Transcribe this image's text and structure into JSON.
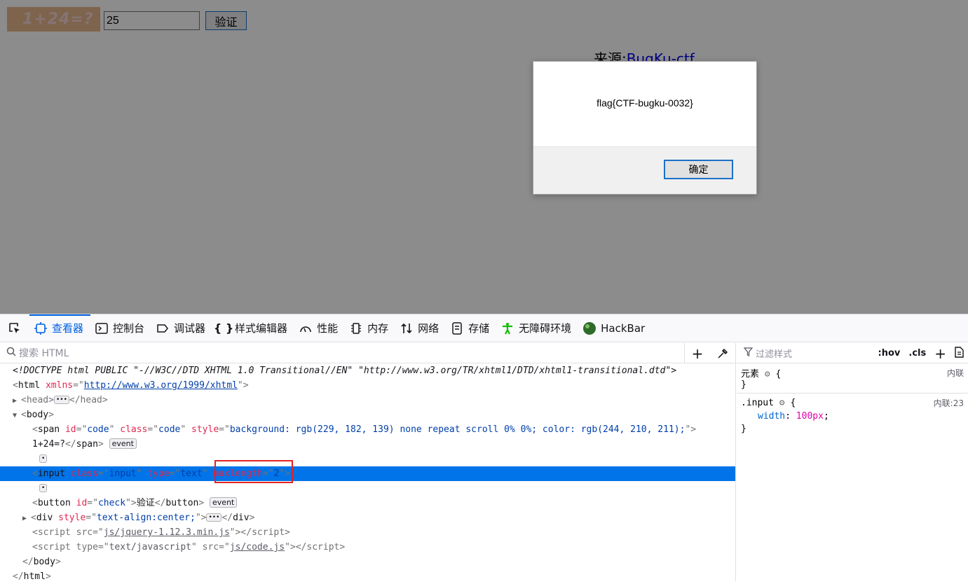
{
  "page": {
    "captcha_text": "1+24=?",
    "answer_value": "25",
    "verify_label": "验证",
    "source_prefix": "来源:",
    "source_link": "BugKu-ctf"
  },
  "dialog": {
    "message": "flag{CTF-bugku-0032}",
    "ok_label": "确定"
  },
  "devtools": {
    "tabs": [
      {
        "label": "查看器",
        "icon": "inspector-icon"
      },
      {
        "label": "控制台",
        "icon": "console-icon"
      },
      {
        "label": "调试器",
        "icon": "debugger-icon"
      },
      {
        "label": "样式编辑器",
        "icon": "style-editor-icon"
      },
      {
        "label": "性能",
        "icon": "performance-icon"
      },
      {
        "label": "内存",
        "icon": "memory-icon"
      },
      {
        "label": "网络",
        "icon": "network-icon"
      },
      {
        "label": "存储",
        "icon": "storage-icon"
      },
      {
        "label": "无障碍环境",
        "icon": "accessibility-icon"
      },
      {
        "label": "HackBar",
        "icon": "hackbar-icon"
      }
    ],
    "search_placeholder": "搜索 HTML",
    "filter_placeholder": "过滤样式",
    "hov_label": ":hov",
    "cls_label": ".cls",
    "markup": {
      "doctype": "<!DOCTYPE html PUBLIC \"-//W3C//DTD XHTML 1.0 Transitional//EN\" \"http://www.w3.org/TR/xhtml1/DTD/xhtml1-transitional.dtd\">",
      "html_xmlns": "http://www.w3.org/1999/xhtml",
      "span_style": "background: rgb(229, 182, 139) none repeat scroll 0% 0%; color: rgb(244, 210, 211);",
      "span_text": "1+24=?",
      "event_badge": "event",
      "button_text": "验证",
      "div_style": "text-align:center;",
      "script1_src": "js/jquery-1.12.3.min.js",
      "script2_src": "js/code.js"
    },
    "rules": {
      "element_selector": "元素",
      "element_source": "内联",
      "input_selector": ".input",
      "input_source": "内联:23",
      "input_prop": "width",
      "input_value": "100px"
    }
  },
  "colors": {
    "captcha_bg": "#e5b68b",
    "captcha_fg": "#f4d2d3",
    "selected_row": "#0074e8",
    "highlight_box": "#e22222"
  }
}
